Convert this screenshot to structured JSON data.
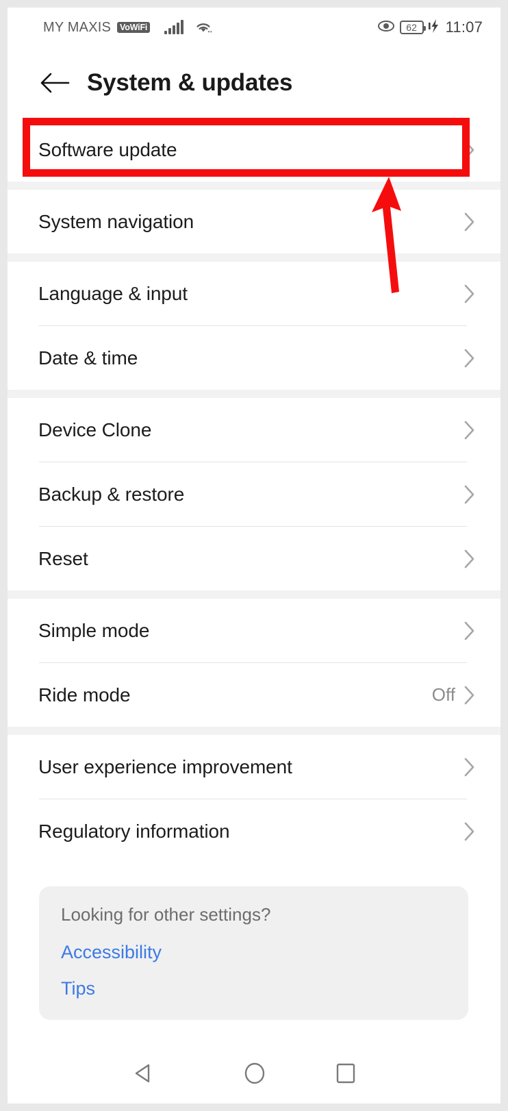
{
  "status_bar": {
    "carrier": "MY MAXIS",
    "vowifi_badge": "VoWiFi",
    "signal_icon": "signal-bars-icon",
    "wifi_icon": "wifi-icon",
    "eye_icon": "eye-icon",
    "battery_level": "62",
    "charging_icon": "charging-bolt-icon",
    "time": "11:07"
  },
  "header": {
    "back_icon": "back-arrow-icon",
    "title": "System & updates"
  },
  "groups": [
    {
      "rows": [
        {
          "label": "Software update",
          "value": "",
          "chevron": "chevron-right-icon",
          "highlighted": true
        }
      ]
    },
    {
      "rows": [
        {
          "label": "System navigation",
          "value": "",
          "chevron": "chevron-right-icon"
        }
      ]
    },
    {
      "rows": [
        {
          "label": "Language & input",
          "value": "",
          "chevron": "chevron-right-icon"
        },
        {
          "label": "Date & time",
          "value": "",
          "chevron": "chevron-right-icon"
        }
      ]
    },
    {
      "rows": [
        {
          "label": "Device Clone",
          "value": "",
          "chevron": "chevron-right-icon"
        },
        {
          "label": "Backup & restore",
          "value": "",
          "chevron": "chevron-right-icon"
        },
        {
          "label": "Reset",
          "value": "",
          "chevron": "chevron-right-icon"
        }
      ]
    },
    {
      "rows": [
        {
          "label": "Simple mode",
          "value": "",
          "chevron": "chevron-right-icon"
        },
        {
          "label": "Ride mode",
          "value": "Off",
          "chevron": "chevron-right-icon"
        }
      ]
    },
    {
      "rows": [
        {
          "label": "User experience improvement",
          "value": "",
          "chevron": "chevron-right-icon"
        },
        {
          "label": "Regulatory information",
          "value": "",
          "chevron": "chevron-right-icon"
        }
      ]
    }
  ],
  "helper_card": {
    "title": "Looking for other settings?",
    "links": [
      {
        "label": "Accessibility"
      },
      {
        "label": "Tips"
      }
    ]
  },
  "nav_bar": {
    "back_icon": "nav-back-triangle-icon",
    "home_icon": "nav-home-circle-icon",
    "recents_icon": "nav-recents-square-icon"
  },
  "annotations": {
    "highlight_box_color": "#f50d0d",
    "arrow_color": "#f50d0d",
    "target_row": "Software update"
  },
  "colors": {
    "link_blue": "#3c7ae4",
    "row_text": "#1c1c1c",
    "muted_text": "#8c8c8c",
    "background": "#f2f2f2",
    "card": "#f0f0f0"
  }
}
